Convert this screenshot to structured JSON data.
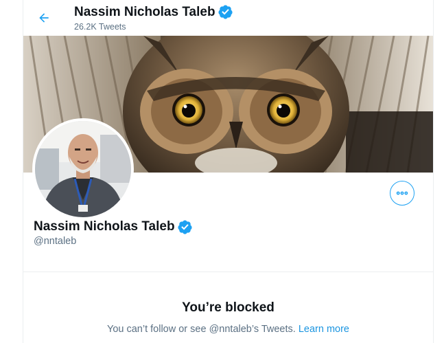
{
  "header": {
    "back_icon": "arrow-left-icon",
    "title": "Nassim Nicholas Taleb",
    "tweet_count": "26.2K Tweets",
    "verified_icon": "verified-badge-icon"
  },
  "banner": {
    "description_icon": "owl-banner-image"
  },
  "profile": {
    "name": "Nassim Nicholas Taleb",
    "handle": "@nntaleb",
    "more_icon": "more-options-icon"
  },
  "blocked": {
    "title": "You’re blocked",
    "message": "You can’t follow or see @nntaleb’s Tweets.",
    "link": "Learn more"
  },
  "colors": {
    "accent": "#1da1f2",
    "link": "#1b95e0",
    "muted_text": "#5b7083",
    "border": "#ebeef0"
  }
}
